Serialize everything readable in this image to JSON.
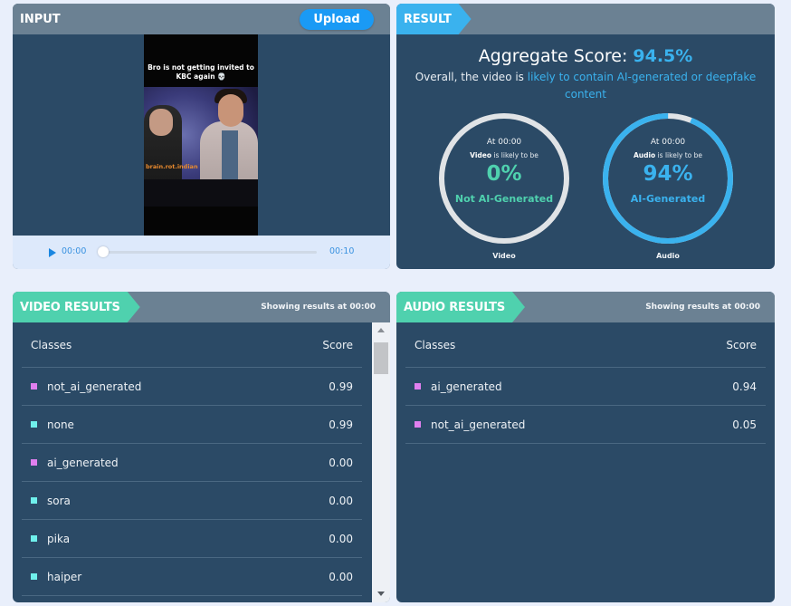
{
  "input": {
    "title": "INPUT",
    "upload_label": "Upload",
    "video": {
      "caption": "Bro is not getting invited to KBC again 💀",
      "watermark": "brain.rot.indian"
    },
    "player": {
      "current_time": "00:00",
      "total_time": "00:10",
      "progress": 0
    }
  },
  "result": {
    "title": "RESULT",
    "aggregate_label": "Aggregate Score:",
    "aggregate_value": "94.5%",
    "overall_prefix": "Overall, the video is ",
    "overall_highlight": "likely to contain AI-generated or deepfake content",
    "gauges": [
      {
        "at": "At 00:00",
        "subject": "Video",
        "likely_suffix": " is likely to be",
        "percent_text": "0%",
        "percent": 0,
        "verdict": "Not AI-Generated",
        "caption": "Video",
        "color": "#4fd1ae"
      },
      {
        "at": "At 00:00",
        "subject": "Audio",
        "likely_suffix": " is likely to be",
        "percent_text": "94%",
        "percent": 94,
        "verdict": "AI-Generated",
        "caption": "Audio",
        "color": "#3ab2ee"
      }
    ]
  },
  "video_results": {
    "title": "VIDEO RESULTS",
    "showing_prefix": "Showing results at ",
    "showing_time": "00:00",
    "col_classes": "Classes",
    "col_score": "Score",
    "rows": [
      {
        "name": "not_ai_generated",
        "score": "0.99",
        "color": "#e07fef"
      },
      {
        "name": "none",
        "score": "0.99",
        "color": "#6ff0ec"
      },
      {
        "name": "ai_generated",
        "score": "0.00",
        "color": "#e07fef"
      },
      {
        "name": "sora",
        "score": "0.00",
        "color": "#6ff0ec"
      },
      {
        "name": "pika",
        "score": "0.00",
        "color": "#6ff0ec"
      },
      {
        "name": "haiper",
        "score": "0.00",
        "color": "#6ff0ec"
      }
    ]
  },
  "audio_results": {
    "title": "AUDIO RESULTS",
    "showing_prefix": "Showing results at ",
    "showing_time": "00:00",
    "col_classes": "Classes",
    "col_score": "Score",
    "rows": [
      {
        "name": "ai_generated",
        "score": "0.94",
        "color": "#e07fef"
      },
      {
        "name": "not_ai_generated",
        "score": "0.05",
        "color": "#e07fef"
      }
    ]
  },
  "colors": {
    "accent_blue": "#3ab2ee",
    "accent_teal": "#4fd1ae",
    "panel_bg": "#2b4a66",
    "header_bg": "#6b8193",
    "gauge_track": "#e0e3e6"
  }
}
